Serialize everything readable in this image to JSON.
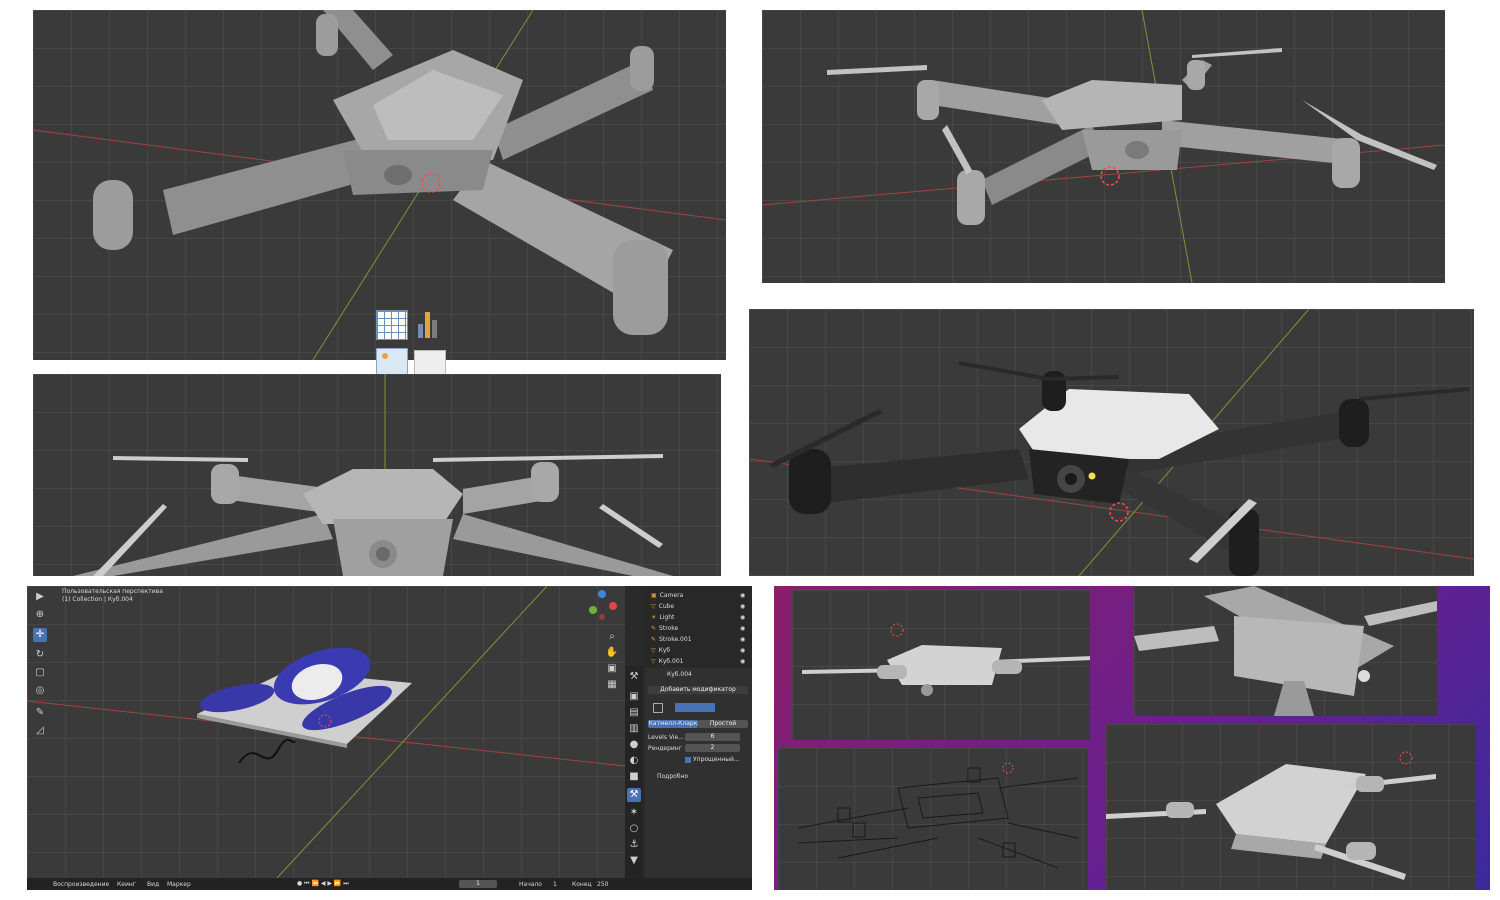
{
  "colors": {
    "viewport_bg": "#3a3a3a",
    "grid_line": "#474747",
    "axis_red": "#b04545",
    "axis_green": "#7e9a3a",
    "model_gray": "#9a9a9a",
    "model_dark": "#2b2b2b",
    "accent_blue": "#4772b3",
    "purple_bg": "#6b1f8a"
  },
  "icons": [
    "spreadsheet-icon",
    "bar-chart-icon",
    "image-icon",
    "blank-image-icon",
    "cursor-icon",
    "move-icon",
    "rotate-icon",
    "scale-icon",
    "transform-icon",
    "annotate-icon",
    "measure-icon",
    "eye-icon",
    "camera-icon",
    "light-icon"
  ],
  "editor": {
    "viewport": {
      "mode_label": "Пользовательская перспектива",
      "collection_label": "(1) Collection | Куб.004"
    },
    "outliner": {
      "items": [
        {
          "name": "Camera",
          "type": "camera"
        },
        {
          "name": "Cube",
          "type": "mesh"
        },
        {
          "name": "Light",
          "type": "light"
        },
        {
          "name": "Stroke",
          "type": "gpencil"
        },
        {
          "name": "Stroke.001",
          "type": "gpencil"
        },
        {
          "name": "Куб",
          "type": "mesh"
        },
        {
          "name": "Куб.001",
          "type": "mesh"
        }
      ]
    },
    "properties": {
      "object_name": "Куб.004",
      "add_modifier": "Добавить модификатор",
      "tab_active": "Катмелл-Кларк",
      "tab_other": "Простой",
      "levels_label": "Levels Vie...",
      "levels_value": "6",
      "render_label": "Рендеринг",
      "render_value": "2",
      "simplified_label": "Упрощенный...",
      "details_label": "Подробно"
    },
    "timeline": {
      "playback": "Воспроизведение",
      "keying": "Кеинг",
      "view": "Вид",
      "marker": "Маркер",
      "current_frame": "1",
      "start_label": "Начало",
      "start_value": "1",
      "end_label": "Конец",
      "end_value": "250"
    }
  }
}
